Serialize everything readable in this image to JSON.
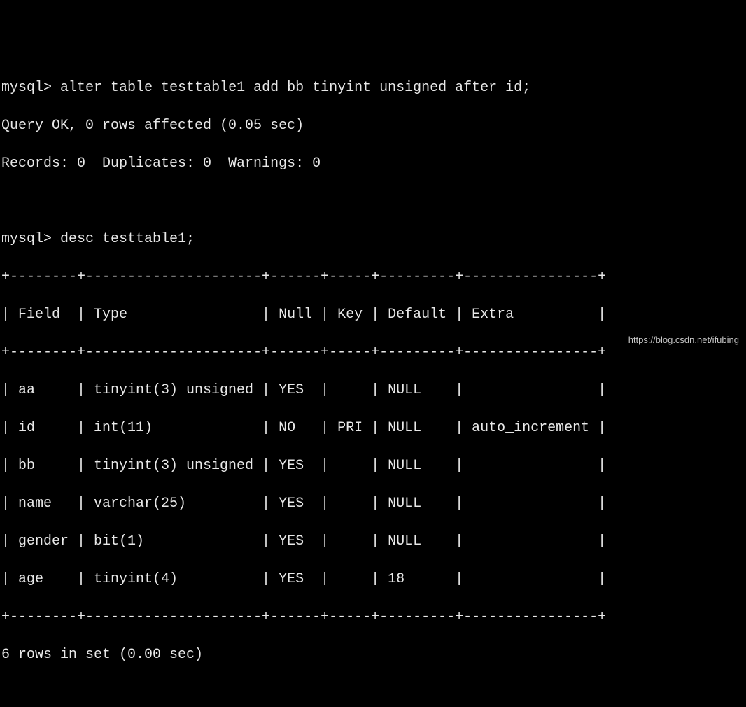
{
  "prompt": "mysql>",
  "commands": {
    "alter": "alter table testtable1 add bb tinyint unsigned after id;",
    "desc": "desc testtable1;"
  },
  "responses": {
    "query_ok": "Query OK, 0 rows affected (0.05 sec)",
    "records": "Records: 0  Duplicates: 0  Warnings: 0",
    "rows_in_set": "6 rows in set (0.00 sec)"
  },
  "table": {
    "border": "+--------+---------------------+------+-----+---------+----------------+",
    "header": "| Field  | Type                | Null | Key | Default | Extra          |",
    "columns": [
      "Field",
      "Type",
      "Null",
      "Key",
      "Default",
      "Extra"
    ],
    "rows": [
      {
        "line": "| aa     | tinyint(3) unsigned | YES  |     | NULL    |                |",
        "Field": "aa",
        "Type": "tinyint(3) unsigned",
        "Null": "YES",
        "Key": "",
        "Default": "NULL",
        "Extra": ""
      },
      {
        "line": "| id     | int(11)             | NO   | PRI | NULL    | auto_increment |",
        "Field": "id",
        "Type": "int(11)",
        "Null": "NO",
        "Key": "PRI",
        "Default": "NULL",
        "Extra": "auto_increment"
      },
      {
        "line": "| bb     | tinyint(3) unsigned | YES  |     | NULL    |                |",
        "Field": "bb",
        "Type": "tinyint(3) unsigned",
        "Null": "YES",
        "Key": "",
        "Default": "NULL",
        "Extra": ""
      },
      {
        "line": "| name   | varchar(25)         | YES  |     | NULL    |                |",
        "Field": "name",
        "Type": "varchar(25)",
        "Null": "YES",
        "Key": "",
        "Default": "NULL",
        "Extra": ""
      },
      {
        "line": "| gender | bit(1)              | YES  |     | NULL    |                |",
        "Field": "gender",
        "Type": "bit(1)",
        "Null": "YES",
        "Key": "",
        "Default": "NULL",
        "Extra": ""
      },
      {
        "line": "| age    | tinyint(4)          | YES  |     | 18      |                |",
        "Field": "age",
        "Type": "tinyint(4)",
        "Null": "YES",
        "Key": "",
        "Default": "18",
        "Extra": ""
      }
    ]
  },
  "watermark": "https://blog.csdn.net/ifubing"
}
